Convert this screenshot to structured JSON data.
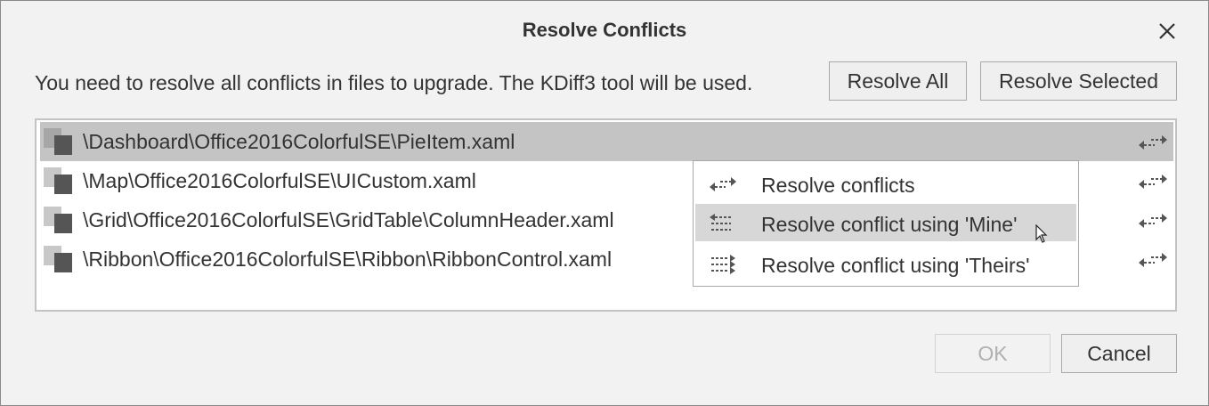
{
  "dialog": {
    "title": "Resolve Conflicts",
    "message": "You need to resolve all conflicts in files to upgrade. The KDiff3 tool will be used.",
    "resolve_all_label": "Resolve All",
    "resolve_selected_label": "Resolve Selected",
    "ok_label": "OK",
    "cancel_label": "Cancel"
  },
  "files": [
    {
      "path": "\\Dashboard\\Office2016ColorfulSE\\PieItem.xaml",
      "selected": true
    },
    {
      "path": "\\Map\\Office2016ColorfulSE\\UICustom.xaml",
      "selected": false
    },
    {
      "path": "\\Grid\\Office2016ColorfulSE\\GridTable\\ColumnHeader.xaml",
      "selected": false
    },
    {
      "path": "\\Ribbon\\Office2016ColorfulSE\\Ribbon\\RibbonControl.xaml",
      "selected": false
    }
  ],
  "context_menu": {
    "items": [
      {
        "label": "Resolve conflicts",
        "icon": "resolve-both-icon"
      },
      {
        "label": "Resolve conflict using 'Mine'",
        "icon": "resolve-mine-icon",
        "hovered": true
      },
      {
        "label": "Resolve conflict using 'Theirs'",
        "icon": "resolve-theirs-icon"
      }
    ]
  },
  "colors": {
    "dialog_bg": "#f2f2f2",
    "selected_row": "#c4c4c4",
    "menu_hover": "#d7d7d7",
    "text": "#333333"
  }
}
